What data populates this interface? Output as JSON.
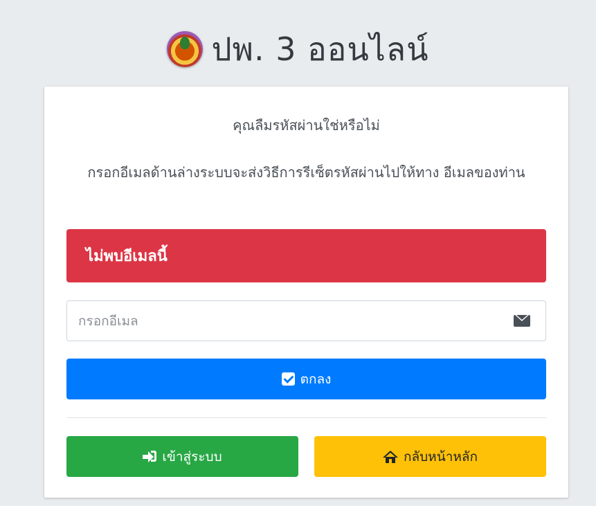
{
  "brand": {
    "title": "ปพ. 3 ออนไลน์",
    "logo": "school-emblem-logo"
  },
  "card": {
    "message_title": "คุณลืมรหัสผ่านใช่หรือไม่",
    "message_instruction": "กรอกอีเมลด้านล่างระบบจะส่งวิธีการรีเซ็ตรหัสผ่านไปให้ทาง อีเมลของท่าน",
    "alert_text": "ไม่พบอีเมลนี้",
    "email_input": {
      "placeholder": "กรอกอีเมล",
      "value": "",
      "icon": "envelope-icon"
    },
    "submit_button": {
      "label": "ตกลง",
      "icon": "check-square-icon"
    },
    "login_button": {
      "label": "เข้าสู่ระบบ",
      "icon": "sign-in-icon"
    },
    "home_button": {
      "label": "กลับหน้าหลัก",
      "icon": "home-icon"
    }
  },
  "colors": {
    "alert": "#dc3545",
    "primary": "#007bff",
    "success": "#28a745",
    "warning": "#ffc107",
    "page_background": "#e9ecef"
  }
}
